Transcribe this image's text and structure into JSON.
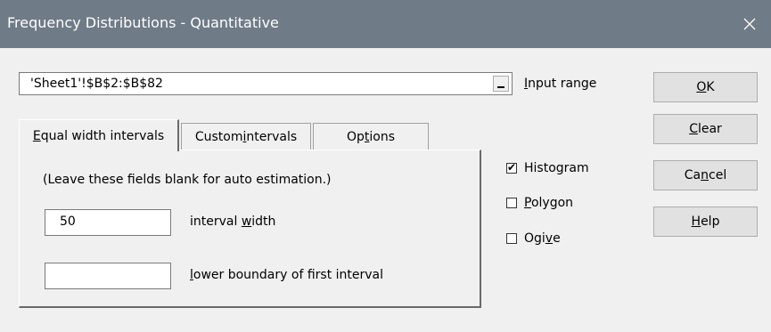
{
  "window": {
    "title": "Frequency Distributions - Quantitative",
    "close_icon": "close-icon"
  },
  "input_range": {
    "value": "'Sheet1'!$B$2:$B$82",
    "label_hotkey": "I",
    "label_rest": "nput range"
  },
  "buttons": {
    "ok": {
      "pre": "",
      "hotkey": "O",
      "post": "K"
    },
    "clear": {
      "pre": "",
      "hotkey": "C",
      "post": "lear"
    },
    "cancel": {
      "pre": "Ca",
      "hotkey": "n",
      "post": "cel"
    },
    "help": {
      "pre": "",
      "hotkey": "H",
      "post": "elp"
    }
  },
  "tabs": [
    {
      "pre": "",
      "hotkey": "E",
      "post": "qual width intervals",
      "active": true
    },
    {
      "pre": "Custom ",
      "hotkey": "i",
      "post": "ntervals",
      "active": false
    },
    {
      "pre": "Op",
      "hotkey": "t",
      "post": "ions",
      "active": false
    }
  ],
  "panel": {
    "hint": "(Leave these fields  blank for auto estimation.)",
    "interval_width": {
      "value": "50",
      "label_pre": "interval ",
      "label_hotkey": "w",
      "label_post": "idth"
    },
    "lower_boundary": {
      "value": "",
      "label_pre": "",
      "label_hotkey": "l",
      "label_post": "ower boundary of first interval"
    }
  },
  "options": [
    {
      "pre": "Histogram",
      "hotkey": "",
      "post": "",
      "checked": true
    },
    {
      "pre": "",
      "hotkey": "P",
      "post": "olygon",
      "checked": false
    },
    {
      "pre": "Ogi",
      "hotkey": "v",
      "post": "e",
      "checked": false
    }
  ],
  "check_glyph": "✔"
}
